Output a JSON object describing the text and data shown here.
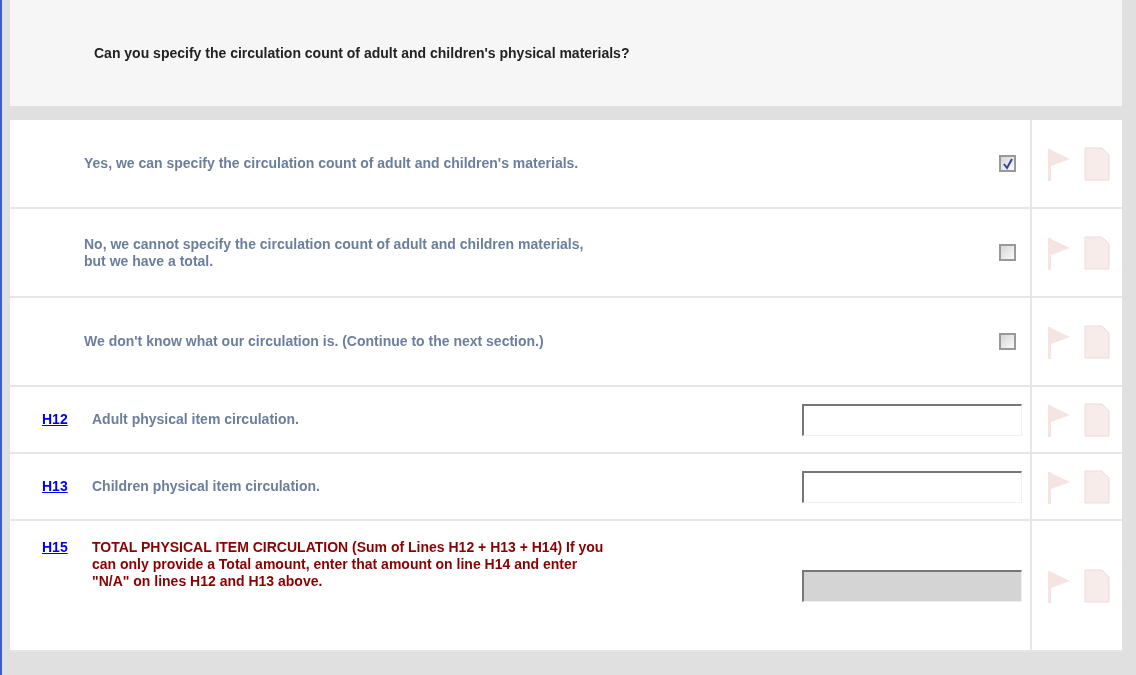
{
  "question": "Can you specify the circulation count of adult and children's physical materials?",
  "rows": [
    {
      "kind": "option",
      "label": "Yes, we can specify the circulation count of adult and children's materials.",
      "checked": true
    },
    {
      "kind": "option",
      "label": "No, we cannot specify the circulation count of adult and children materials, but we have a total.",
      "checked": false
    },
    {
      "kind": "option",
      "label": "We don't know what our circulation is. (Continue to the next section.)",
      "checked": false
    },
    {
      "kind": "field",
      "code": "H12",
      "label": "Adult physical item circulation."
    },
    {
      "kind": "field",
      "code": "H13",
      "label": "Children physical item circulation."
    },
    {
      "kind": "total",
      "code": "H15",
      "label": "TOTAL PHYSICAL ITEM CIRCULATION (Sum of Lines H12 + H13 + H14) If you can only provide a Total amount, enter that amount on line H14 and enter \"N/A\" on lines H12 and H13 above."
    }
  ]
}
